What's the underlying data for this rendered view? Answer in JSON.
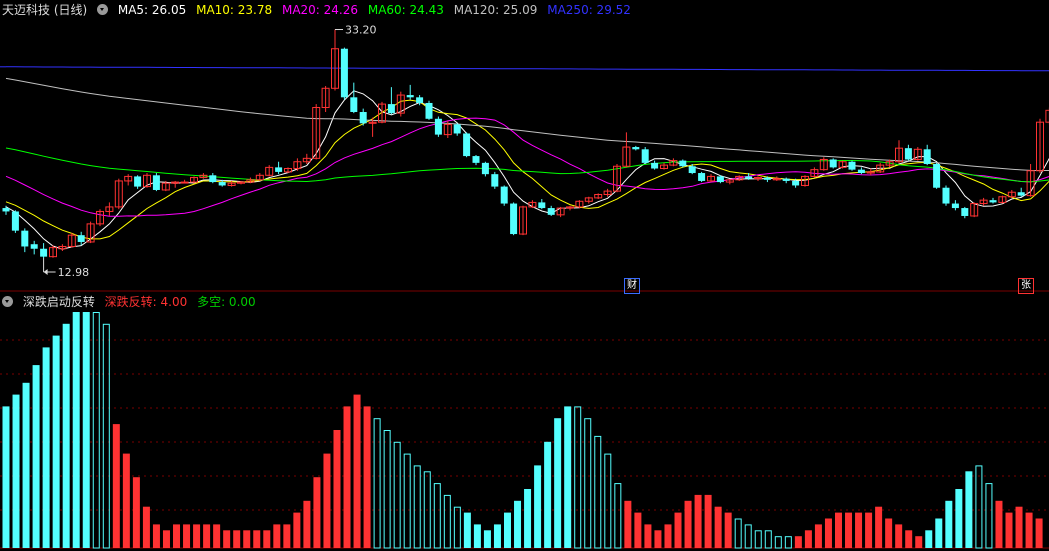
{
  "colors": {
    "up": "#ff3232",
    "down": "#54ffff",
    "ma5": "#ffffff",
    "ma10": "#ffff00",
    "ma20": "#ff00ff",
    "ma60": "#00ff00",
    "ma120": "#c0c0c0",
    "ma250": "#3232ff",
    "grid": "#7a0000"
  },
  "header": {
    "stock_name": "天迈科技 (日线)",
    "ma5": "MA5: 26.05",
    "ma10": "MA10: 23.78",
    "ma20": "MA20: 24.26",
    "ma60": "MA60: 24.43",
    "ma120": "MA120: 25.09",
    "ma250": "MA250: 29.52"
  },
  "price_labels": {
    "high": "33.20",
    "low": "12.98"
  },
  "markers": {
    "cai": "财",
    "zhang": "张"
  },
  "indicator": {
    "title": "深跌启动反转",
    "value_label": "深跌反转: 4.00",
    "dk_label": "多空: 0.00"
  },
  "icons": [
    "dropdown-icon",
    "arrow-left-icon"
  ],
  "chart_data": [
    {
      "type": "candlestick",
      "title": "天迈科技 (日线)",
      "annotations": [
        "33.20",
        "12.98"
      ],
      "candles": [
        [
          17.4,
          17.6,
          16.8,
          17.1
        ],
        [
          17.1,
          17.2,
          15.2,
          15.4
        ],
        [
          15.4,
          15.6,
          13.5,
          14.0
        ],
        [
          14.2,
          14.5,
          13.3,
          13.8
        ],
        [
          13.8,
          14.3,
          12.98,
          13.1
        ],
        [
          13.1,
          14.1,
          13.0,
          13.9
        ],
        [
          13.8,
          14.2,
          13.6,
          14.0
        ],
        [
          14.0,
          15.2,
          13.9,
          15.0
        ],
        [
          15.0,
          15.3,
          14.1,
          14.4
        ],
        [
          14.4,
          16.2,
          14.3,
          16.0
        ],
        [
          16.0,
          17.3,
          15.8,
          17.1
        ],
        [
          17.1,
          17.9,
          16.7,
          17.5
        ],
        [
          17.5,
          20.0,
          17.3,
          19.8
        ],
        [
          19.8,
          20.4,
          19.4,
          20.2
        ],
        [
          20.2,
          20.3,
          19.1,
          19.3
        ],
        [
          19.3,
          20.5,
          19.2,
          20.3
        ],
        [
          20.3,
          20.5,
          18.9,
          19.0
        ],
        [
          19.0,
          19.8,
          18.9,
          19.6
        ],
        [
          19.6,
          19.8,
          19.2,
          19.7
        ],
        [
          19.7,
          19.9,
          19.6,
          19.7
        ],
        [
          19.7,
          20.2,
          19.6,
          20.1
        ],
        [
          20.1,
          20.5,
          20.0,
          20.3
        ],
        [
          20.3,
          20.5,
          19.6,
          19.7
        ],
        [
          19.7,
          19.9,
          19.3,
          19.4
        ],
        [
          19.4,
          19.8,
          19.3,
          19.6
        ],
        [
          19.6,
          19.8,
          19.5,
          19.7
        ],
        [
          19.7,
          20.1,
          19.6,
          19.9
        ],
        [
          19.9,
          20.5,
          19.8,
          20.3
        ],
        [
          20.3,
          21.2,
          20.2,
          21.0
        ],
        [
          21.0,
          21.5,
          20.4,
          20.6
        ],
        [
          20.6,
          21.0,
          20.5,
          20.9
        ],
        [
          20.9,
          21.8,
          20.7,
          21.5
        ],
        [
          21.5,
          22.2,
          21.3,
          21.8
        ],
        [
          21.8,
          26.6,
          21.7,
          26.3
        ],
        [
          26.3,
          28.2,
          25.9,
          28.0
        ],
        [
          28.0,
          33.2,
          27.8,
          31.5
        ],
        [
          31.5,
          31.6,
          27.0,
          27.2
        ],
        [
          27.2,
          28.5,
          25.8,
          25.9
        ],
        [
          25.9,
          26.2,
          24.7,
          24.9
        ],
        [
          24.9,
          25.4,
          23.7,
          25.0
        ],
        [
          25.0,
          26.8,
          24.9,
          26.6
        ],
        [
          26.6,
          28.1,
          25.7,
          25.8
        ],
        [
          25.8,
          27.7,
          25.5,
          27.4
        ],
        [
          27.4,
          28.3,
          27.0,
          27.2
        ],
        [
          27.2,
          27.4,
          26.5,
          26.7
        ],
        [
          26.7,
          26.9,
          25.2,
          25.3
        ],
        [
          25.3,
          25.5,
          23.7,
          23.9
        ],
        [
          23.9,
          25.1,
          23.6,
          24.8
        ],
        [
          24.8,
          24.9,
          23.8,
          24.0
        ],
        [
          24.0,
          24.1,
          21.9,
          22.0
        ],
        [
          22.0,
          22.1,
          21.2,
          21.4
        ],
        [
          21.4,
          21.5,
          20.2,
          20.4
        ],
        [
          20.4,
          20.6,
          19.1,
          19.3
        ],
        [
          19.3,
          19.4,
          17.6,
          17.8
        ],
        [
          17.8,
          17.9,
          15.0,
          15.1
        ],
        [
          15.1,
          17.6,
          15.0,
          17.5
        ],
        [
          17.5,
          18.1,
          17.4,
          17.9
        ],
        [
          17.9,
          18.2,
          17.3,
          17.4
        ],
        [
          17.4,
          17.6,
          16.7,
          16.8
        ],
        [
          16.8,
          17.5,
          16.6,
          17.4
        ],
        [
          17.4,
          17.6,
          17.2,
          17.5
        ],
        [
          17.5,
          18.1,
          17.4,
          18.0
        ],
        [
          18.0,
          18.4,
          17.8,
          18.3
        ],
        [
          18.3,
          18.7,
          18.2,
          18.6
        ],
        [
          18.6,
          19.1,
          18.4,
          18.9
        ],
        [
          18.9,
          21.3,
          18.8,
          21.1
        ],
        [
          21.1,
          24.1,
          21.0,
          22.8
        ],
        [
          22.8,
          22.9,
          22.5,
          22.6
        ],
        [
          22.6,
          22.8,
          21.3,
          21.4
        ],
        [
          21.4,
          21.6,
          20.8,
          20.9
        ],
        [
          20.9,
          21.4,
          20.8,
          21.2
        ],
        [
          21.2,
          21.8,
          21.1,
          21.6
        ],
        [
          21.6,
          21.7,
          21.0,
          21.1
        ],
        [
          21.1,
          21.3,
          20.4,
          20.5
        ],
        [
          20.5,
          20.6,
          19.7,
          19.8
        ],
        [
          19.8,
          20.4,
          19.7,
          20.2
        ],
        [
          20.2,
          20.3,
          19.6,
          19.7
        ],
        [
          19.7,
          19.9,
          19.5,
          19.9
        ],
        [
          19.9,
          20.3,
          19.8,
          20.2
        ],
        [
          20.2,
          20.5,
          19.9,
          20.0
        ],
        [
          20.0,
          20.2,
          19.8,
          20.1
        ],
        [
          20.1,
          20.2,
          19.7,
          19.9
        ],
        [
          19.9,
          20.2,
          19.8,
          20.0
        ],
        [
          20.0,
          20.1,
          19.6,
          19.8
        ],
        [
          19.8,
          20.0,
          19.2,
          19.4
        ],
        [
          19.4,
          20.3,
          19.3,
          20.2
        ],
        [
          20.2,
          21.0,
          20.1,
          20.8
        ],
        [
          20.8,
          21.9,
          20.7,
          21.7
        ],
        [
          21.7,
          21.8,
          20.9,
          21.0
        ],
        [
          21.0,
          21.6,
          20.9,
          21.5
        ],
        [
          21.5,
          21.6,
          20.7,
          20.8
        ],
        [
          20.8,
          21.0,
          20.4,
          20.5
        ],
        [
          20.5,
          20.9,
          20.3,
          20.6
        ],
        [
          20.6,
          21.4,
          20.5,
          21.2
        ],
        [
          21.2,
          21.7,
          21.0,
          21.5
        ],
        [
          21.5,
          23.4,
          21.4,
          22.7
        ],
        [
          22.7,
          23.0,
          21.6,
          21.7
        ],
        [
          21.7,
          22.8,
          21.6,
          22.6
        ],
        [
          22.6,
          23.0,
          21.2,
          21.3
        ],
        [
          21.3,
          21.4,
          19.1,
          19.2
        ],
        [
          19.2,
          19.4,
          17.6,
          17.8
        ],
        [
          17.8,
          18.1,
          17.2,
          17.4
        ],
        [
          17.4,
          17.5,
          16.5,
          16.7
        ],
        [
          16.7,
          17.9,
          16.6,
          17.8
        ],
        [
          17.8,
          18.3,
          17.6,
          18.1
        ],
        [
          18.1,
          18.3,
          17.8,
          17.9
        ],
        [
          17.9,
          18.5,
          17.8,
          18.4
        ],
        [
          18.4,
          19.0,
          18.3,
          18.8
        ],
        [
          18.8,
          19.2,
          18.4,
          18.5
        ],
        [
          18.5,
          21.3,
          18.4,
          20.7
        ],
        [
          20.7,
          25.3,
          20.5,
          25.0
        ],
        [
          25.0,
          26.3,
          24.8,
          26.05
        ]
      ]
    },
    {
      "type": "bar",
      "title": "深跌启动反转",
      "legend": [
        "深跌反转: 4.00",
        "多空: 0.00"
      ],
      "values": [
        "c:24",
        "c:26",
        "c:28",
        "c:31",
        "c:34",
        "c:36",
        "c:38",
        "c:40",
        "c:40",
        "o:40",
        "o:38",
        "r:21",
        "r:16",
        "r:12",
        "r:7",
        "r:4",
        "r:3",
        "r:4",
        "r:4",
        "r:4",
        "r:4",
        "r:4",
        "r:3",
        "r:3",
        "r:3",
        "r:3",
        "r:3",
        "r:4",
        "r:4",
        "r:6",
        "r:8",
        "r:12",
        "r:16",
        "r:20",
        "r:24",
        "r:26",
        "r:24",
        "o:22",
        "o:20",
        "o:18",
        "o:16",
        "o:14",
        "o:13",
        "o:11",
        "o:9",
        "o:7",
        "c:6",
        "c:4",
        "c:3",
        "c:4",
        "c:6",
        "c:8",
        "c:10",
        "c:14",
        "c:18",
        "c:22",
        "c:24",
        "o:24",
        "o:22",
        "o:19",
        "o:16",
        "o:11",
        "r:8",
        "r:6",
        "r:4",
        "r:3",
        "r:4",
        "r:6",
        "r:8",
        "r:9",
        "r:9",
        "r:7",
        "r:6",
        "o:5",
        "o:4",
        "o:3",
        "o:3",
        "o:2",
        "o:2",
        "r:2",
        "r:3",
        "r:4",
        "r:5",
        "r:6",
        "r:6",
        "r:6",
        "r:6",
        "r:7",
        "r:5",
        "r:4",
        "r:3",
        "r:2",
        "c:3",
        "c:5",
        "c:8",
        "c:10",
        "c:13",
        "o:14",
        "o:11",
        "r:8",
        "r:6",
        "r:7",
        "r:6",
        "r:5"
      ]
    }
  ]
}
